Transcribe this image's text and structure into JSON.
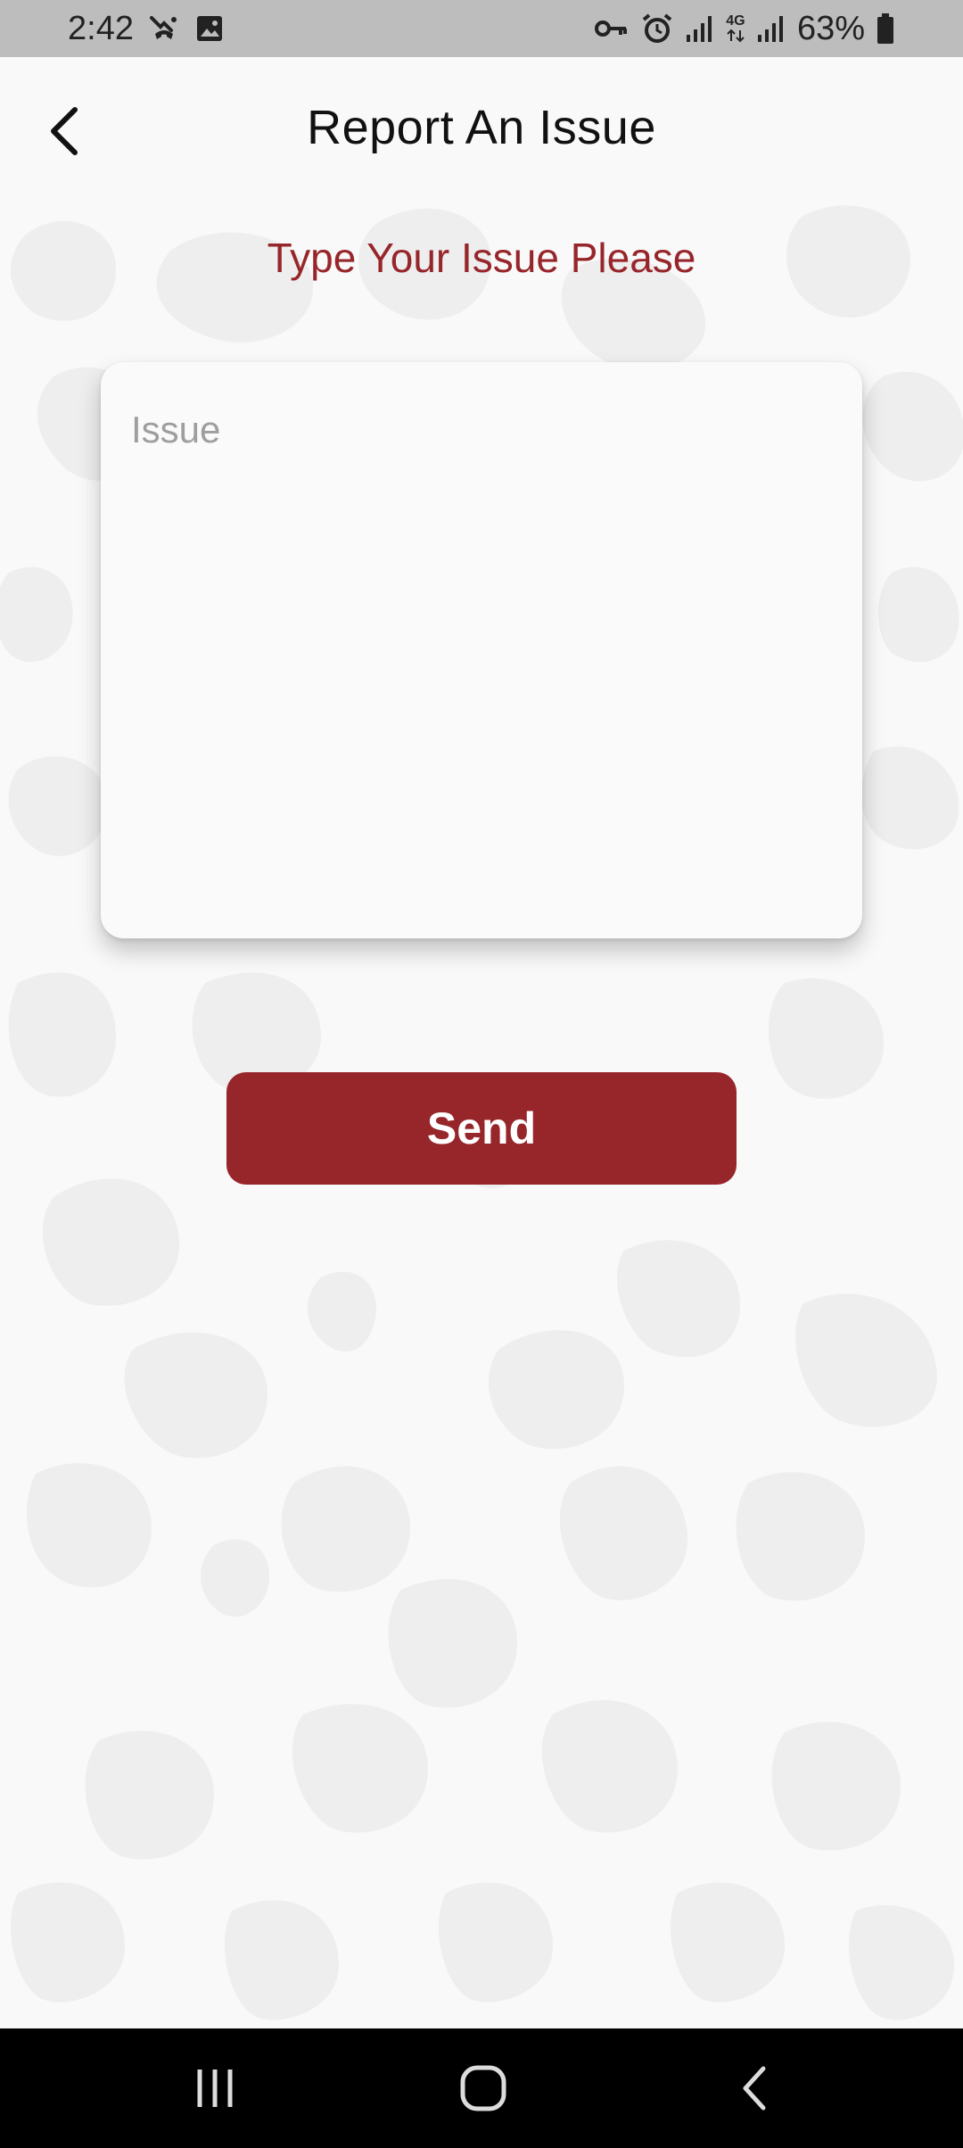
{
  "status_bar": {
    "time": "2:42",
    "battery": "63%",
    "network_type": "4G",
    "icons_left": [
      "missed-call-icon",
      "gallery-icon"
    ],
    "icons_right": [
      "vpn-key-icon",
      "alarm-icon",
      "signal-icon",
      "signal-icon",
      "battery-icon"
    ]
  },
  "app_bar": {
    "title": "Report An Issue",
    "back_icon": "back-arrow-icon"
  },
  "form": {
    "subtitle": "Type Your Issue Please",
    "issue_placeholder": "Issue",
    "issue_value": "",
    "send_label": "Send"
  },
  "nav_bar": {
    "icons": [
      "recent-apps-icon",
      "home-icon",
      "back-icon"
    ]
  },
  "colors": {
    "accent": "#97262b",
    "background": "#f9f9f9",
    "pattern": "#eeeeee",
    "status_bar": "#bdbdbd",
    "nav_bar": "#000000"
  }
}
